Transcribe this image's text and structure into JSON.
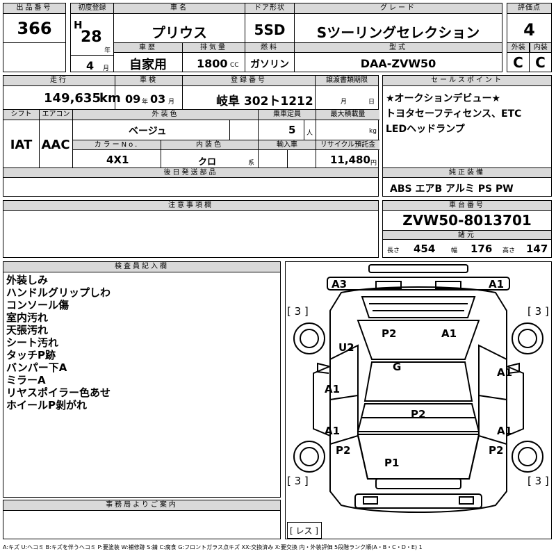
{
  "labels": {
    "lot_no": "出品番号",
    "first_reg": "初度登録",
    "car_name": "車名",
    "door": "ドア形状",
    "grade": "グレード",
    "score": "評価点",
    "history": "車歴",
    "displacement": "排気量",
    "fuel": "燃料",
    "model": "型式",
    "exterior": "外装",
    "interior": "内装",
    "mileage": "走行",
    "inspection": "車検",
    "plate": "登録番号",
    "transfer": "譲渡書類期限",
    "sellpoint": "セールスポイント",
    "shift": "シフト",
    "aircon": "エアコン",
    "ext_color": "外装色",
    "capacity": "乗車定員",
    "load": "最大積載量",
    "color_no": "カラーNo.",
    "int_color": "内装色",
    "import": "輸入車",
    "recycle": "リサイクル預託金",
    "later_parts": "後日発送部品",
    "equipment": "純正装備",
    "caution": "注意事項欄",
    "chassis": "車台番号",
    "specs": "諸元",
    "inspector": "検査員記入欄",
    "office": "事務局よりご案内"
  },
  "vehicle": {
    "lot_no": "366",
    "era": "H",
    "year": "28",
    "year_unit": "年",
    "month": "4",
    "month_unit": "月",
    "name": "プリウス",
    "door": "5SD",
    "grade": "Sツーリングセレクション",
    "score": "4",
    "history": "自家用",
    "displacement": "1800",
    "cc": "CC",
    "fuel": "ガソリン",
    "model": "DAA-ZVW50",
    "exterior_grade": "C",
    "interior_grade": "C",
    "mileage": "149,635",
    "km": "km",
    "insp_year": "09",
    "insp_year_unit": "年",
    "insp_month": "03",
    "insp_month_unit": "月",
    "plate": "岐阜 302ト1212",
    "transfer_month": "月",
    "transfer_day": "日",
    "shift": "IAT",
    "aircon": "AAC",
    "ext_color": "ベージュ",
    "capacity": "5",
    "capacity_unit": "人",
    "load_unit": "kg",
    "color_no": "4X1",
    "int_color": "クロ",
    "int_color_unit": "系",
    "recycle": "11,480",
    "recycle_unit": "円",
    "equipment": "ABS エアB アルミ PS PW",
    "chassis": "ZVW50-8013701",
    "len_label": "長さ",
    "length": "454",
    "wid_label": "幅",
    "width": "176",
    "hgt_label": "高さ",
    "height": "147"
  },
  "sales_points": [
    "★オークションデビュー★",
    "トヨタセーフティセンス、ETC",
    "LEDヘッドランプ"
  ],
  "inspector_notes": [
    "外装しみ",
    "ハンドルグリップしわ",
    "コンソール傷",
    "室内汚れ",
    "天張汚れ",
    "シート汚れ",
    "タッチP跡",
    "バンパー下A",
    "ミラーA",
    "リヤスポイラー色あせ",
    "ホイールP剝がれ"
  ],
  "diagram": {
    "a3": "A3",
    "a1_tr": "A1",
    "tl3": "[ 3 ]",
    "tr3": "[ 3 ]",
    "bl3": "[ 3 ]",
    "br3": "[ 3 ]",
    "p2_top": "P2",
    "a1_top": "A1",
    "u2": "U2",
    "g": "G",
    "a1_ml": "A1",
    "a1_mr": "A1",
    "p2_mid": "P2",
    "a1_bl": "A1",
    "a1_br": "A1",
    "p2_bl": "P2",
    "p2_br": "P2",
    "p1": "P1",
    "res": "[ レス ]"
  },
  "legend": "A:キズ U:ヘコミ B:キズを伴うヘコミ P:要塗装 W:補修跡 S:錆 C:腐食 G:フロントガラス点キズ XX:交換済み X:要交換 内・外装評価 5段階ランク順(A・B・C・D・E) 1"
}
